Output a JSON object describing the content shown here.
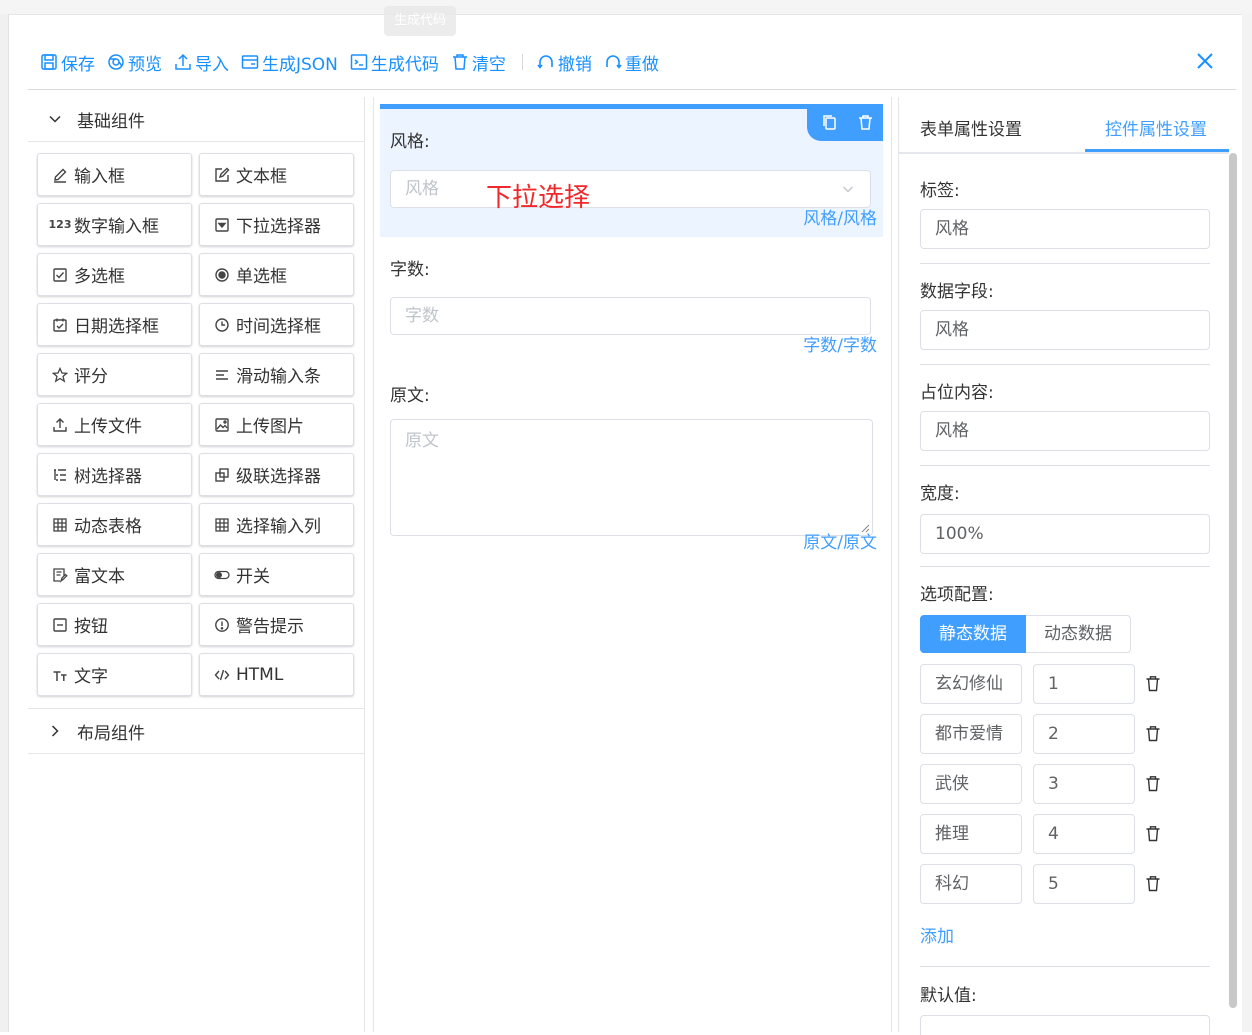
{
  "tooltip": "生成代码",
  "toolbar": {
    "items": [
      {
        "label": "保存",
        "icon": "save-icon"
      },
      {
        "label": "预览",
        "icon": "preview-icon"
      },
      {
        "label": "导入",
        "icon": "import-icon"
      },
      {
        "label": "生成JSON",
        "icon": "json-icon"
      },
      {
        "label": "生成代码",
        "icon": "code-icon"
      },
      {
        "label": "清空",
        "icon": "trash-icon"
      },
      {
        "label": "撤销",
        "icon": "undo-icon"
      },
      {
        "label": "重做",
        "icon": "redo-icon"
      }
    ],
    "accent": "#1890ff"
  },
  "left": {
    "basic_title": "基础组件",
    "layout_title": "布局组件",
    "components": [
      {
        "label": "输入框",
        "icon": "pencil-icon"
      },
      {
        "label": "文本框",
        "icon": "edit-box-icon"
      },
      {
        "label": "数字输入框",
        "icon": "number-icon",
        "glyph": "123"
      },
      {
        "label": "下拉选择器",
        "icon": "dropdown-icon"
      },
      {
        "label": "多选框",
        "icon": "checkbox-icon"
      },
      {
        "label": "单选框",
        "icon": "radio-icon"
      },
      {
        "label": "日期选择框",
        "icon": "calendar-icon"
      },
      {
        "label": "时间选择框",
        "icon": "clock-icon"
      },
      {
        "label": "评分",
        "icon": "star-icon"
      },
      {
        "label": "滑动输入条",
        "icon": "slider-icon"
      },
      {
        "label": "上传文件",
        "icon": "upload-icon"
      },
      {
        "label": "上传图片",
        "icon": "image-icon"
      },
      {
        "label": "树选择器",
        "icon": "tree-icon"
      },
      {
        "label": "级联选择器",
        "icon": "cascader-icon"
      },
      {
        "label": "动态表格",
        "icon": "table-icon"
      },
      {
        "label": "选择输入列",
        "icon": "table-icon"
      },
      {
        "label": "富文本",
        "icon": "richtext-icon"
      },
      {
        "label": "开关",
        "icon": "switch-icon"
      },
      {
        "label": "按钮",
        "icon": "button-icon"
      },
      {
        "label": "警告提示",
        "icon": "alert-icon"
      },
      {
        "label": "文字",
        "icon": "text-icon"
      },
      {
        "label": "HTML",
        "icon": "html-icon"
      }
    ]
  },
  "canvas": {
    "fields": [
      {
        "label": "风格:",
        "placeholder": "风格",
        "key": "风格/风格",
        "type": "select"
      },
      {
        "label": "字数:",
        "placeholder": "字数",
        "key": "字数/字数",
        "type": "input"
      },
      {
        "label": "原文:",
        "placeholder": "原文",
        "key": "原文/原文",
        "type": "textarea"
      }
    ],
    "annotation": "下拉选择",
    "annotation_color": "#f0282b"
  },
  "right": {
    "tabs": [
      "表单属性设置",
      "控件属性设置"
    ],
    "active_tab": 1,
    "label_title": "标签:",
    "label_value": "风格",
    "field_title": "数据字段:",
    "field_value": "风格",
    "placeholder_title": "占位内容:",
    "placeholder_value": "风格",
    "width_title": "宽度:",
    "width_value": "100%",
    "options_title": "选项配置:",
    "seg_static": "静态数据",
    "seg_dynamic": "动态数据",
    "options": [
      {
        "label": "玄幻修仙",
        "value": "1"
      },
      {
        "label": "都市爱情",
        "value": "2"
      },
      {
        "label": "武侠",
        "value": "3"
      },
      {
        "label": "推理",
        "value": "4"
      },
      {
        "label": "科幻",
        "value": "5"
      }
    ],
    "add_label": "添加",
    "default_title": "默认值:"
  }
}
